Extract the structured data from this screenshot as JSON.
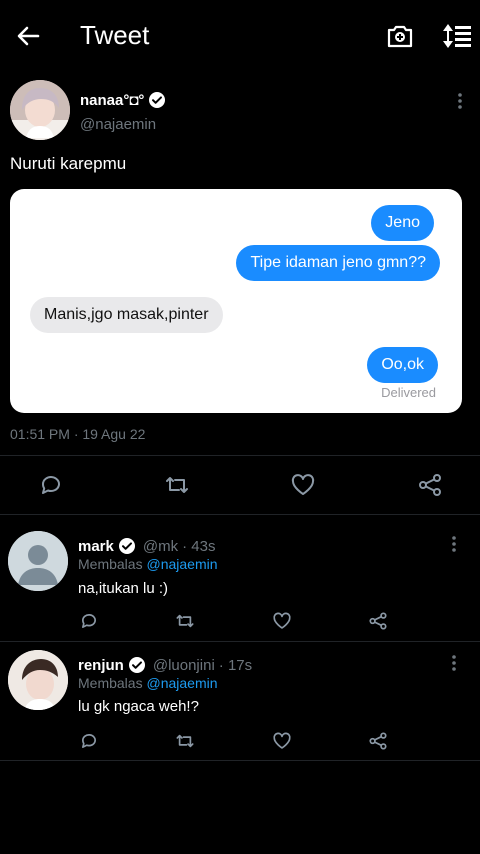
{
  "header": {
    "title": "Tweet"
  },
  "tweet": {
    "display_name": "nanaa°◘°",
    "handle": "@najaemin",
    "text": "Nuruti karepmu",
    "timestamp": "01:51 PM · 19 Agu 22",
    "chat": {
      "messages": [
        {
          "text": "Jeno",
          "side": "right"
        },
        {
          "text": "Tipe idaman jeno gmn??",
          "side": "right"
        },
        {
          "text": "Manis,jgo masak,pinter",
          "side": "left"
        },
        {
          "text": "Oo,ok",
          "side": "right"
        }
      ],
      "status": "Delivered"
    }
  },
  "replies": [
    {
      "name": "mark",
      "handle": "@mk",
      "age": "· 43s",
      "replying_prefix": "Membalas",
      "replying_to": "@najaemin",
      "text": "na,itukan lu :)"
    },
    {
      "name": "renjun",
      "handle": "@luonjini",
      "age": "· 17s",
      "replying_prefix": "Membalas",
      "replying_to": "@najaemin",
      "text": "lu gk ngaca weh!?"
    }
  ],
  "colors": {
    "background": "#000000",
    "accent": "#1d9bf0",
    "imessage_blue": "#1a8cff",
    "muted": "#6e767d"
  },
  "icons": [
    "back-arrow-icon",
    "camera-add-icon",
    "sort-icon",
    "verified-icon",
    "more-vertical-icon",
    "reply-icon",
    "retweet-icon",
    "like-icon",
    "share-icon"
  ]
}
